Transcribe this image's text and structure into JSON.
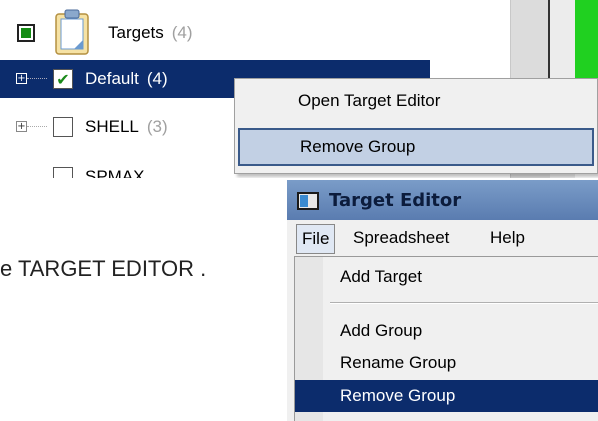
{
  "tree": {
    "root": {
      "label": "Targets",
      "count": "(4)"
    },
    "items": [
      {
        "label": "Default",
        "count": "(4)"
      },
      {
        "label": "SHELL",
        "count": "(3)"
      },
      {
        "label": "SPMAX",
        "count": ""
      }
    ]
  },
  "context_menu": {
    "items": [
      {
        "label": "Open Target Editor"
      },
      {
        "label": "Remove Group"
      }
    ]
  },
  "caption": {
    "text": "e TARGET EDITOR ."
  },
  "editor": {
    "title": "Target Editor",
    "menubar": {
      "file": "File",
      "spreadsheet": "Spreadsheet",
      "help": "Help"
    },
    "file_menu": {
      "items": [
        {
          "label": "Add Target"
        },
        {
          "label": "Add Group"
        },
        {
          "label": "Rename Group"
        },
        {
          "label": "Remove Group"
        }
      ]
    }
  },
  "colors": {
    "selection_dark": "#0c2c6c",
    "context_highlight": "#c2d0e4",
    "status_green": "#20d020"
  },
  "icons": {
    "root_state": "checkbox-partial-icon",
    "root_node": "clipboard-icon",
    "expand": "plus-expander-icon",
    "window": "app-window-icon"
  }
}
